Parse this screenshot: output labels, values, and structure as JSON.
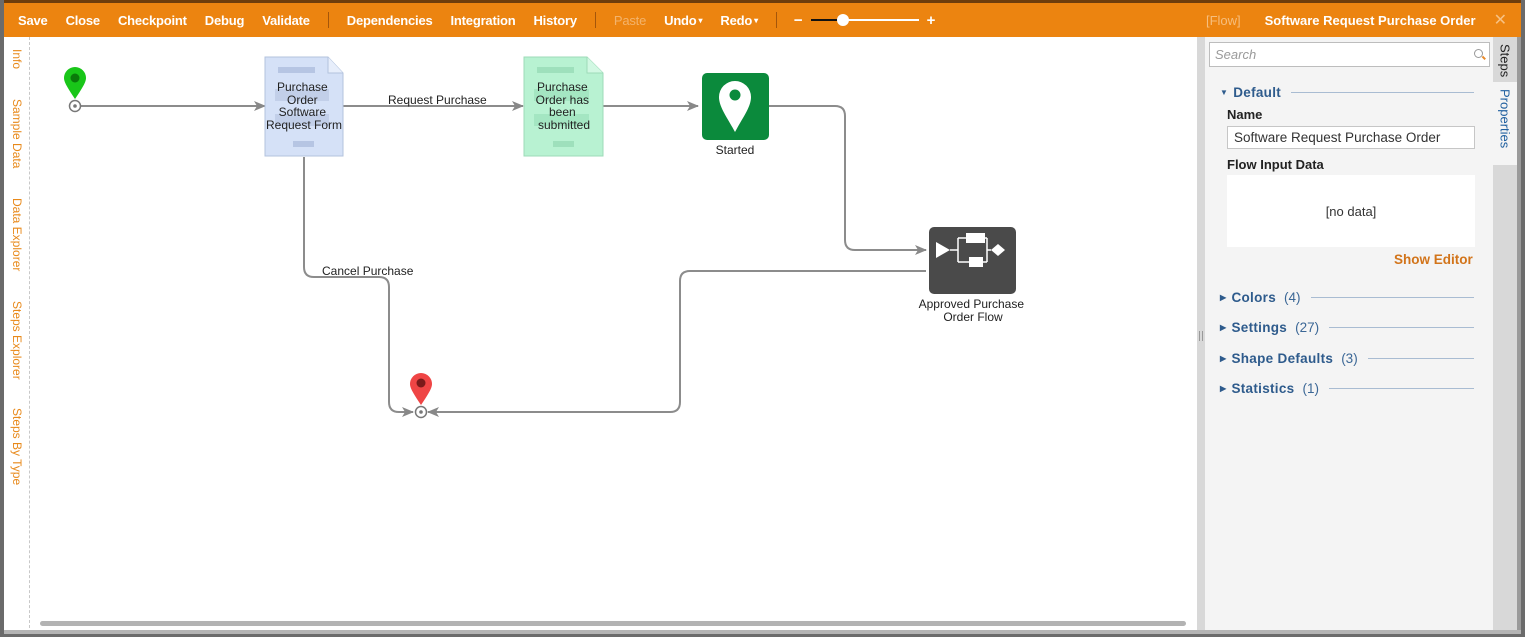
{
  "toolbar": {
    "save": "Save",
    "close": "Close",
    "checkpoint": "Checkpoint",
    "debug": "Debug",
    "validate": "Validate",
    "dependencies": "Dependencies",
    "integration": "Integration",
    "history": "History",
    "paste": "Paste",
    "undo": "Undo",
    "redo": "Redo",
    "zoom_minus": "−",
    "zoom_plus": "+",
    "zoom_level": 0.3,
    "caret": "▾"
  },
  "header": {
    "flow_tag": "[Flow]",
    "title": "Software Request Purchase Order",
    "close_icon": "✕"
  },
  "left_tabs": [
    "Info",
    "Sample Data",
    "Data Explorer",
    "Steps Explorer",
    "Steps By Type"
  ],
  "diagram": {
    "nodes": {
      "start": {
        "type": "start-pin",
        "color": "#1fbf1f"
      },
      "form": {
        "lines": [
          "Purchase",
          "Order",
          "Software",
          "Request Form"
        ],
        "color": "#d5e1f7"
      },
      "submitted": {
        "lines": [
          "Purchase",
          "Order has",
          "been",
          "submitted"
        ],
        "color": "#b8f2d2"
      },
      "started": {
        "label": "Started",
        "color": "#0b8a3c"
      },
      "approved": {
        "lines": [
          "Approved Purchase",
          "Order Flow"
        ],
        "color": "#4a4a4a"
      },
      "end": {
        "type": "end-pin",
        "color": "#ef4545"
      }
    },
    "connectors": [
      {
        "from": "start",
        "to": "form",
        "label": ""
      },
      {
        "from": "form",
        "to": "submitted",
        "label": "Request  Purchase"
      },
      {
        "from": "submitted",
        "to": "started",
        "label": ""
      },
      {
        "from": "started",
        "to": "approved",
        "label": ""
      },
      {
        "from": "form",
        "to": "end",
        "label": "Cancel  Purchase"
      },
      {
        "from": "approved",
        "to": "end",
        "label": ""
      }
    ]
  },
  "panel": {
    "search_placeholder": "Search",
    "default_section": "Default",
    "name_label": "Name",
    "name_value": "Software Request Purchase Order",
    "flow_input_label": "Flow Input Data",
    "no_data": "[no data]",
    "show_editor": "Show Editor",
    "sections": [
      {
        "title": "Colors",
        "count": "(4)"
      },
      {
        "title": "Settings",
        "count": "(27)"
      },
      {
        "title": "Shape Defaults",
        "count": "(3)"
      },
      {
        "title": "Statistics",
        "count": "(1)"
      }
    ]
  },
  "right_tabs": {
    "steps": "Steps",
    "properties": "Properties"
  }
}
